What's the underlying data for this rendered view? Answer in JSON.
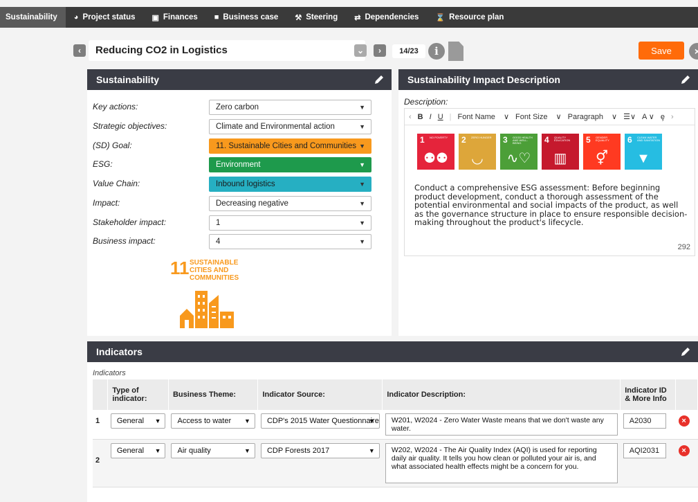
{
  "nav": {
    "items": [
      {
        "label": "Sustainability",
        "icon": "",
        "active": true
      },
      {
        "label": "Project status",
        "icon": "dashboard-icon"
      },
      {
        "label": "Finances",
        "icon": "money-icon"
      },
      {
        "label": "Business case",
        "icon": "briefcase-icon"
      },
      {
        "label": "Steering",
        "icon": "gavel-icon"
      },
      {
        "label": "Dependencies",
        "icon": "exchange-icon"
      },
      {
        "label": "Resource plan",
        "icon": "hourglass-icon"
      }
    ]
  },
  "header": {
    "title": "Reducing CO2 in Logistics",
    "counter": "14/23",
    "save_label": "Save"
  },
  "sustainability": {
    "title": "Sustainability",
    "fields": [
      {
        "label": "Key actions:",
        "value": "Zero carbon"
      },
      {
        "label": "Strategic objectives:",
        "value": "Climate and Environmental action"
      },
      {
        "label": "(SD) Goal:",
        "value": "11. Sustainable Cities and Communities",
        "color": "#f8991d"
      },
      {
        "label": "ESG:",
        "value": "Environment",
        "color": "#1e9a4c"
      },
      {
        "label": "Value Chain:",
        "value": "Inbound logistics",
        "color": "#26afc2"
      },
      {
        "label": "Impact:",
        "value": "Decreasing negative"
      },
      {
        "label": "Stakeholder impact:",
        "value": "1"
      },
      {
        "label": "Business impact:",
        "value": "4"
      }
    ],
    "sdg_logo": {
      "number": "11",
      "text": "SUSTAINABLE CITIES AND COMMUNITIES"
    }
  },
  "impact": {
    "title": "Sustainability Impact Description",
    "description_label": "Description:",
    "toolbar": {
      "font_name": "Font Name",
      "font_size": "Font Size",
      "paragraph": "Paragraph"
    },
    "tiles": [
      {
        "num": "1",
        "text": "NO POVERTY",
        "color": "#e5243b"
      },
      {
        "num": "2",
        "text": "ZERO HUNGER",
        "color": "#dda63a"
      },
      {
        "num": "3",
        "text": "GOOD HEALTH AND WELL-BEING",
        "color": "#4c9f38"
      },
      {
        "num": "4",
        "text": "QUALITY EDUCATION",
        "color": "#c5192d"
      },
      {
        "num": "5",
        "text": "GENDER EQUALITY",
        "color": "#ff3a21"
      },
      {
        "num": "6",
        "text": "CLEAN WATER AND SANITATION",
        "color": "#26bde2"
      }
    ],
    "text": "Conduct a comprehensive ESG assessment: Before beginning product development, conduct a thorough assessment of the potential environmental and social impacts of the product, as well as the governance structure in place to ensure responsible decision-making throughout the product's lifecycle.",
    "char_count": "292"
  },
  "indicators": {
    "title": "Indicators",
    "subtitle": "Indicators",
    "columns": {
      "type": "Type of indicator:",
      "theme": "Business Theme:",
      "source": "Indicator Source:",
      "description": "Indicator Description:",
      "id": "Indicator ID & More Info"
    },
    "rows": [
      {
        "n": "1",
        "type": "General",
        "theme": "Access to water",
        "source": "CDP's 2015 Water Questionnaire",
        "description": "W201, W2024 - Zero Water Waste means that we don't waste any water.",
        "id": "A2030"
      },
      {
        "n": "2",
        "type": "General",
        "theme": "Air quality",
        "source": "CDP Forests 2017",
        "description": "W202, W2024 - The Air Quality Index (AQI) is used for reporting daily air quality. It tells you how clean or polluted your air is, and what associated health effects might be a concern for you.",
        "id": "AQI2031"
      }
    ]
  }
}
